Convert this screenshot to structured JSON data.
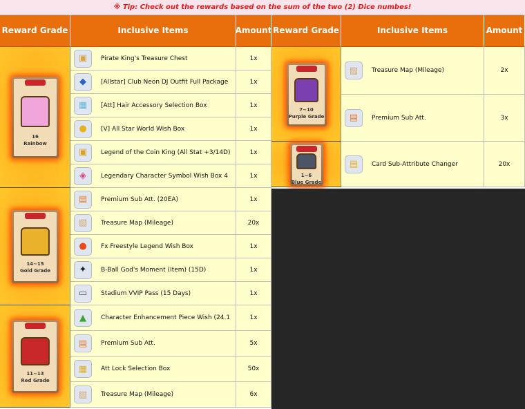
{
  "tip": "※ Tip: Check out the rewards based on the sum of the two (2) Dice numbes!",
  "headers": {
    "grade": "Reward Grade",
    "items": "Inclusive Items",
    "amount": "Amount"
  },
  "left_groups": [
    {
      "range": "16",
      "grade": "Rainbow",
      "chest_color": "#f0a6d8",
      "items": [
        {
          "name": "Pirate King's Treasure Chest",
          "amount": "1x",
          "icon": "treasure-chest-icon",
          "glyph": "▣",
          "color": "#d9a441"
        },
        {
          "name": "[Allstar] Club Neon DJ Outfit Full Package",
          "amount": "1x",
          "icon": "outfit-icon",
          "glyph": "◆",
          "color": "#2a66c8"
        },
        {
          "name": "[Att] Hair Accessory Selection Box",
          "amount": "1x",
          "icon": "selection-box-icon",
          "glyph": "▦",
          "color": "#6bb8d9"
        },
        {
          "name": "[V] All Star World Wish Box",
          "amount": "1x",
          "icon": "wish-box-icon",
          "glyph": "●",
          "color": "#e7b220"
        },
        {
          "name": "Legend of the Coin King (All Stat +3/14D)",
          "amount": "1x",
          "icon": "coin-chest-icon",
          "glyph": "▣",
          "color": "#e0a01e"
        },
        {
          "name": "Legendary Character Symbol Wish Box 4",
          "amount": "1x",
          "icon": "symbol-box-icon",
          "glyph": "◈",
          "color": "#e0408a"
        }
      ]
    },
    {
      "range": "14~15",
      "grade": "Gold Grade",
      "chest_color": "#e9b12c",
      "items": [
        {
          "name": "Premium Sub Att. (20EA)",
          "amount": "1x",
          "icon": "sub-att-card-icon",
          "glyph": "▤",
          "color": "#f07a2a"
        },
        {
          "name": "Treasure Map (Mileage)",
          "amount": "20x",
          "icon": "treasure-map-icon",
          "glyph": "▧",
          "color": "#d6a76a"
        },
        {
          "name": "Fx Freestyle Legend Wish Box",
          "amount": "1x",
          "icon": "wish-box-icon",
          "glyph": "●",
          "color": "#e84a1a"
        },
        {
          "name": "B-Ball God's Moment (Item) (15D)",
          "amount": "1x",
          "icon": "basketball-icon",
          "glyph": "✦",
          "color": "#222222"
        },
        {
          "name": "Stadium VVIP Pass (15 Days)",
          "amount": "1x",
          "icon": "vip-pass-icon",
          "glyph": "▭",
          "color": "#4a4a4a"
        }
      ]
    },
    {
      "range": "11~13",
      "grade": "Red Grade",
      "chest_color": "#c8282a",
      "items": [
        {
          "name": "Character Enhancement Piece Wish (24.1",
          "amount": "1x",
          "icon": "piece-wish-icon",
          "glyph": "▲",
          "color": "#3aa33a"
        },
        {
          "name": "Premium Sub Att.",
          "amount": "5x",
          "icon": "sub-att-card-icon",
          "glyph": "▤",
          "color": "#f07a2a"
        },
        {
          "name": "Att Lock Selection Box",
          "amount": "50x",
          "icon": "selection-box-icon",
          "glyph": "▦",
          "color": "#e0b030"
        },
        {
          "name": "Treasure Map (Mileage)",
          "amount": "6x",
          "icon": "treasure-map-icon",
          "glyph": "▧",
          "color": "#d6a76a"
        }
      ]
    }
  ],
  "right_groups": [
    {
      "range": "7~10",
      "grade": "Purple Grade",
      "chest_color": "#7b3fb0",
      "items": [
        {
          "name": "Treasure Map (Mileage)",
          "amount": "2x",
          "icon": "treasure-map-icon",
          "glyph": "▧",
          "color": "#d6a76a"
        },
        {
          "name": "Premium Sub Att.",
          "amount": "3x",
          "icon": "sub-att-card-icon",
          "glyph": "▤",
          "color": "#f07a2a"
        }
      ]
    },
    {
      "range": "1~6",
      "grade": "Blue Grade",
      "chest_color": "#4a5668",
      "items": [
        {
          "name": "Card Sub-Attribute Changer",
          "amount": "20x",
          "icon": "card-changer-icon",
          "glyph": "▤",
          "color": "#f0b020"
        }
      ]
    }
  ]
}
